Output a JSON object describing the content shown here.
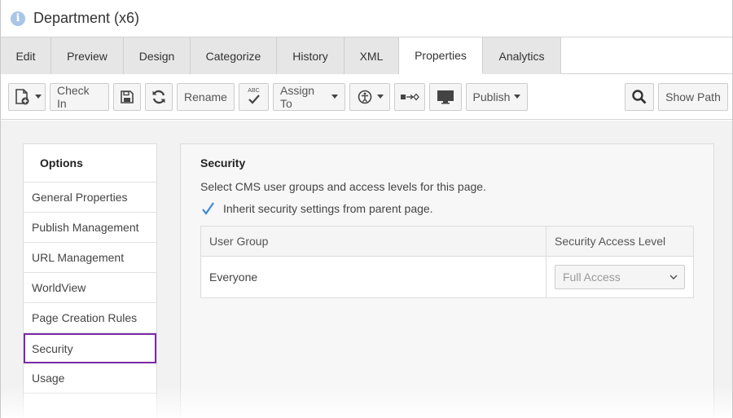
{
  "window": {
    "title": "Department (x6)",
    "icon": "info-icon"
  },
  "tabs": [
    {
      "label": "Edit"
    },
    {
      "label": "Preview"
    },
    {
      "label": "Design"
    },
    {
      "label": "Categorize"
    },
    {
      "label": "History"
    },
    {
      "label": "XML"
    },
    {
      "label": "Properties",
      "active": true
    },
    {
      "label": "Analytics"
    }
  ],
  "toolbar": {
    "check_in": "Check In",
    "rename": "Rename",
    "assign_to": "Assign To",
    "publish": "Publish",
    "show_path": "Show Path",
    "spellcheck_text": "ABC"
  },
  "options": {
    "heading": "Options",
    "items": [
      {
        "label": "General Properties"
      },
      {
        "label": "Publish Management"
      },
      {
        "label": "URL Management"
      },
      {
        "label": "WorldView"
      },
      {
        "label": "Page Creation Rules"
      },
      {
        "label": "Security",
        "selected": true
      },
      {
        "label": "Usage"
      }
    ]
  },
  "security": {
    "title": "Security",
    "description": "Select CMS user groups and access levels for this page.",
    "inherit_label": "Inherit security settings from parent page.",
    "inherit_checked": true,
    "columns": [
      "User Group",
      "Security Access Level"
    ],
    "rows": [
      {
        "group": "Everyone",
        "access": "Full Access"
      }
    ]
  },
  "colors": {
    "selected_border": "#7a2aa6",
    "check": "#3b8ad8",
    "info_icon": "#a9c6e8"
  }
}
